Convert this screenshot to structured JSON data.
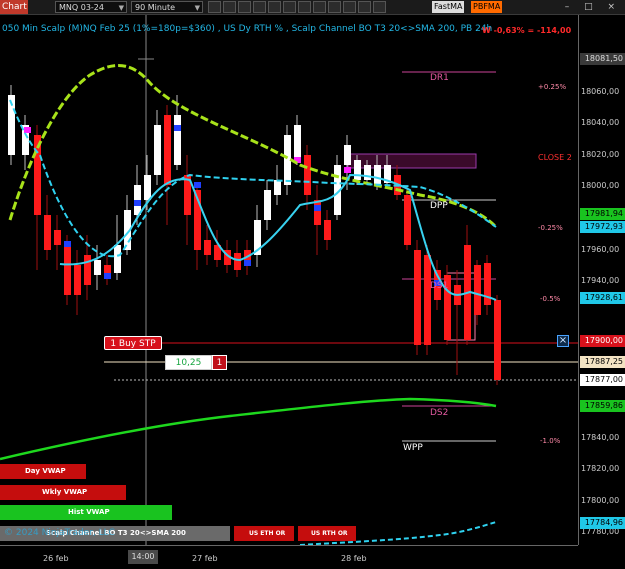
{
  "toolbar": {
    "tab_label": "Chart",
    "instrument": "MNQ 03-24",
    "interval": "90 Minute",
    "indicator_tag_1": "FastMA",
    "indicator_tag_2": "PBFMA",
    "window_controls": "– □ ×"
  },
  "header": {
    "title": "050 Min Scalp (M)NQ Feb 25 (1%=180p=$360) , US Dy RTH % , Scalp Channel BO T3 20<>SMA 200, PB 24h",
    "pnl": "W -0,63% = -114,00"
  },
  "levels": {
    "dr1": "DR1",
    "dpp": "DPP",
    "ds1": "DS1",
    "ds2": "DS2",
    "wpp": "WPP",
    "close2": "CLOSE 2"
  },
  "percent_labels": {
    "p1": "+0.25%",
    "p2": "-0.25%",
    "p3": "-0.5%",
    "p4": "-1.0%"
  },
  "price_axis": {
    "ticks": [
      "18060,00",
      "18040,00",
      "18020,00",
      "18000,00",
      "17960,00",
      "17940,00",
      "17840,00",
      "17820,00",
      "17800,00",
      "17780,00"
    ],
    "tags": [
      {
        "label": "18081,50",
        "bg": "#3a3a3a",
        "fg": "#dddddd"
      },
      {
        "label": "17981,94",
        "bg": "#19c31f",
        "fg": "#000000"
      },
      {
        "label": "17972,93",
        "bg": "#20c8e8",
        "fg": "#000000"
      },
      {
        "label": "17928,61",
        "bg": "#20c8e8",
        "fg": "#000000"
      },
      {
        "label": "17900,00",
        "bg": "#d7111b",
        "fg": "#ffffff"
      },
      {
        "label": "17887,25",
        "bg": "#f3e3c3",
        "fg": "#000000"
      },
      {
        "label": "17877,00",
        "bg": "#ffffff",
        "fg": "#000000"
      },
      {
        "label": "17859,86",
        "bg": "#19c31f",
        "fg": "#000000"
      },
      {
        "label": "17784,96",
        "bg": "#20c8e8",
        "fg": "#000000"
      }
    ]
  },
  "time_axis": {
    "labels": [
      "26 feb",
      "27 feb",
      "28 feb"
    ],
    "cursor": "14:00"
  },
  "order": {
    "buy_stop": "1 Buy STP",
    "quantity_value": "10,25",
    "quantity_count": "1",
    "close_icon": "×"
  },
  "vwap_buttons": {
    "day": "Day VWAP",
    "weekly": "Wkly VWAP",
    "hist": "Hist VWAP",
    "scalp_channel": "Scalp Channel BO T3 20<>SMA 200",
    "us_eth_1": "US ETH OR",
    "us_eth_2": "US RTH OR"
  },
  "watermark": "© 2024 NinjaTrader, LLC",
  "colors": {
    "bull": "#ffffff",
    "bear": "#ff1a1a",
    "ma_fast": "#a8e21a",
    "ma_slow": "#2fd2f0",
    "vwap": "#1ed81e"
  }
}
